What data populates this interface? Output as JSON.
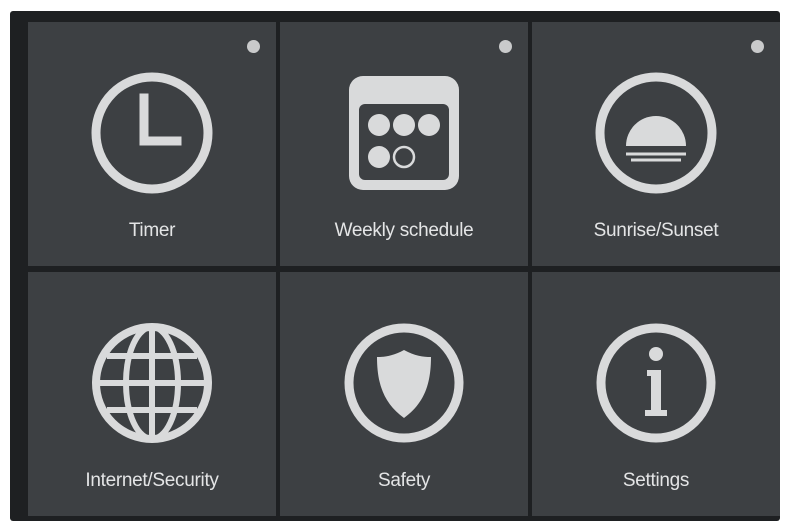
{
  "colors": {
    "background": "#1e2022",
    "tile": "#3d4043",
    "icon": "#d9dadb",
    "text": "#e4e5e6",
    "dot": "#c9cacb"
  },
  "tiles": [
    {
      "label": "Timer",
      "icon": "clock-icon",
      "has_dot": true
    },
    {
      "label": "Weekly schedule",
      "icon": "calendar-icon",
      "has_dot": true
    },
    {
      "label": "Sunrise/Sunset",
      "icon": "sunrise-icon",
      "has_dot": true
    },
    {
      "label": "Internet/Security",
      "icon": "globe-icon",
      "has_dot": false
    },
    {
      "label": "Safety",
      "icon": "shield-icon",
      "has_dot": false
    },
    {
      "label": "Settings",
      "icon": "info-icon",
      "has_dot": false
    }
  ]
}
